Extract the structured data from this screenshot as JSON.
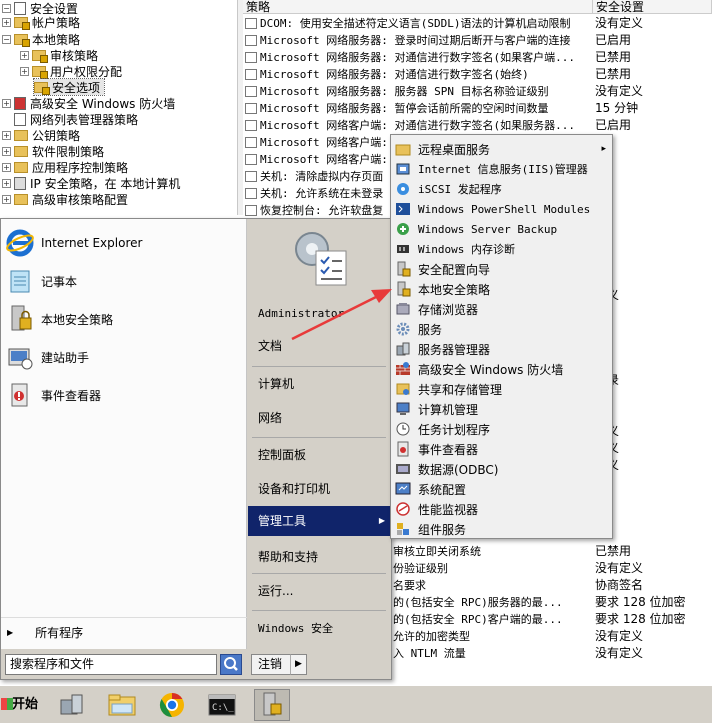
{
  "tree": {
    "items": [
      {
        "label": "安全设置",
        "expand": "−"
      },
      {
        "label": "帐户策略",
        "expand": "+"
      },
      {
        "label": "本地策略",
        "expand": "−"
      },
      {
        "label": "审核策略",
        "expand": "+"
      },
      {
        "label": "用户权限分配",
        "expand": "+"
      },
      {
        "label": "安全选项",
        "expand": ""
      },
      {
        "label": "高级安全 Windows 防火墙",
        "expand": "+"
      },
      {
        "label": "网络列表管理器策略",
        "expand": ""
      },
      {
        "label": "公钥策略",
        "expand": "+"
      },
      {
        "label": "软件限制策略",
        "expand": "+"
      },
      {
        "label": "应用程序控制策略",
        "expand": "+"
      },
      {
        "label": "IP 安全策略，在 本地计算机",
        "expand": "+"
      },
      {
        "label": "高级审核策略配置",
        "expand": "+"
      }
    ]
  },
  "list": {
    "headers": {
      "policy": "策略",
      "setting": "安全设置"
    },
    "rows": [
      {
        "name": "DCOM: 使用安全描述符定义语言(SDDL)语法的计算机启动限制",
        "value": "没有定义"
      },
      {
        "name": "Microsoft 网络服务器: 登录时间过期后断开与客户端的连接",
        "value": "已启用"
      },
      {
        "name": "Microsoft 网络服务器: 对通信进行数字签名(如果客户端...",
        "value": "已禁用"
      },
      {
        "name": "Microsoft 网络服务器: 对通信进行数字签名(始终)",
        "value": "已禁用"
      },
      {
        "name": "Microsoft 网络服务器: 服务器 SPN 目标名称验证级别",
        "value": "没有定义"
      },
      {
        "name": "Microsoft 网络服务器: 暂停会话前所需的空闲时间数量",
        "value": "15 分钟"
      },
      {
        "name": "Microsoft 网络客户端: 对通信进行数字签名(如果服务器...",
        "value": "已启用"
      },
      {
        "name": "Microsoft 网络客户端: ",
        "value": "用"
      },
      {
        "name": "Microsoft 网络客户端: ",
        "value": "用"
      },
      {
        "name": "关机: 清除虚拟内存页面",
        "value": "用"
      },
      {
        "name": "关机: 允许系统在未登录",
        "value": "用"
      },
      {
        "name": "恢复控制台: 允许软盘复",
        "value": "用"
      }
    ],
    "right_fragments": [
      "用",
      "用",
      "用",
      "用",
      "定义",
      "关",
      "用",
      "用",
      "用",
      "登录",
      "作",
      "用",
      "定义",
      "定义",
      "定义",
      "用",
      "用",
      "用",
      "用"
    ],
    "tail_rows": [
      {
        "name": "审核立即关闭系统",
        "value": "已禁用"
      },
      {
        "name": "份验证级别",
        "value": "没有定义"
      },
      {
        "name": "名要求",
        "value": "协商签名"
      },
      {
        "name": "的(包括安全 RPC)服务器的最...",
        "value": "要求 128 位加密"
      },
      {
        "name": "的(包括安全 RPC)客户端的最...",
        "value": "要求 128 位加密"
      },
      {
        "name": "允许的加密类型",
        "value": "没有定义"
      },
      {
        "name": "入 NTLM 流量",
        "value": "没有定义"
      }
    ]
  },
  "start_menu": {
    "programs": [
      {
        "label": "Internet Explorer",
        "icon": "internet-explorer-icon"
      },
      {
        "label": "记事本",
        "icon": "notepad-icon"
      },
      {
        "label": "本地安全策略",
        "icon": "local-security-policy-icon"
      },
      {
        "label": "建站助手",
        "icon": "site-assistant-icon"
      },
      {
        "label": "事件查看器",
        "icon": "event-viewer-icon"
      }
    ],
    "all_programs": "所有程序",
    "search_placeholder": "搜索程序和文件",
    "shutdown": "注销",
    "right_links": {
      "user": "Administrator",
      "documents": "文档",
      "computer": "计算机",
      "network": "网络",
      "control_panel": "控制面板",
      "devices": "设备和打印机",
      "admin_tools": "管理工具",
      "help": "帮助和支持",
      "run": "运行...",
      "security": "Windows 安全"
    }
  },
  "submenu": {
    "items": [
      {
        "label": "远程桌面服务",
        "icon": "folder-icon",
        "has_arrow": "▸"
      },
      {
        "label": "Internet 信息服务(IIS)管理器",
        "icon": "iis-icon"
      },
      {
        "label": "iSCSI 发起程序",
        "icon": "iscsi-icon"
      },
      {
        "label": "Windows PowerShell Modules",
        "icon": "powershell-icon"
      },
      {
        "label": "Windows Server Backup",
        "icon": "backup-icon"
      },
      {
        "label": "Windows 内存诊断",
        "icon": "memory-diagnostic-icon"
      },
      {
        "label": "安全配置向导",
        "icon": "security-wizard-icon"
      },
      {
        "label": "本地安全策略",
        "icon": "local-security-policy-icon"
      },
      {
        "label": "存储浏览器",
        "icon": "storage-explorer-icon"
      },
      {
        "label": "服务",
        "icon": "services-gear-icon"
      },
      {
        "label": "服务器管理器",
        "icon": "server-manager-icon"
      },
      {
        "label": "高级安全 Windows 防火墙",
        "icon": "firewall-icon"
      },
      {
        "label": "共享和存储管理",
        "icon": "share-storage-icon"
      },
      {
        "label": "计算机管理",
        "icon": "computer-management-icon"
      },
      {
        "label": "任务计划程序",
        "icon": "task-scheduler-icon"
      },
      {
        "label": "事件查看器",
        "icon": "event-viewer-icon"
      },
      {
        "label": "数据源(ODBC)",
        "icon": "odbc-icon"
      },
      {
        "label": "系统配置",
        "icon": "system-config-icon"
      },
      {
        "label": "性能监视器",
        "icon": "performance-monitor-icon"
      },
      {
        "label": "组件服务",
        "icon": "component-services-icon"
      }
    ]
  },
  "taskbar": {
    "start_label": "开始",
    "icons": [
      "server-manager-icon",
      "explorer-folder-icon",
      "chrome-icon",
      "cmd-icon",
      "local-security-policy-icon"
    ]
  },
  "colors": {
    "highlight": "#10246a",
    "annotation_arrow": "#e83a3a",
    "menu_bg": "#d4d0c8"
  }
}
